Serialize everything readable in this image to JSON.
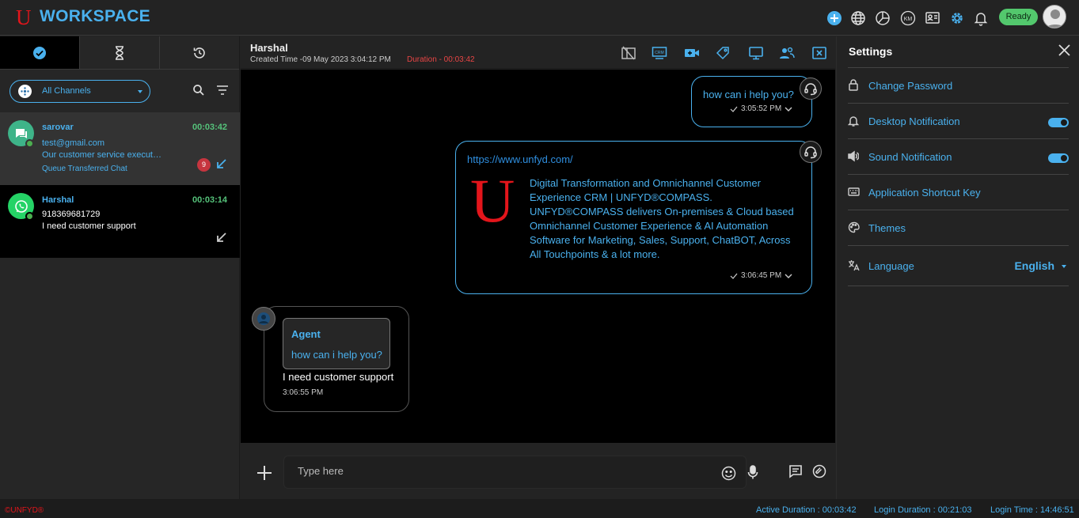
{
  "header": {
    "logo_letter": "U",
    "brand": "WORKSPACE",
    "status_label": "Ready",
    "km_label": "KM"
  },
  "left_panel": {
    "channel_filter": "All Channels",
    "chats": [
      {
        "name": "sarovar",
        "timer": "00:03:42",
        "email": "test@gmail.com",
        "preview": "Our customer service executive will be with you shortly",
        "status": "Queue Transferred Chat",
        "unread": "9",
        "channel": "chat-icon"
      },
      {
        "name": "Harshal",
        "timer": "00:03:14",
        "phone": "918369681729",
        "preview": "I need customer support",
        "channel": "whatsapp-icon"
      }
    ]
  },
  "chat_header": {
    "name": "Harshal",
    "created": "Created Time -09 May 2023 3:04:12 PM",
    "duration": "Duration - 00:03:42"
  },
  "conversation": {
    "msg1": {
      "text": "how can i help you?",
      "time": "3:05:52 PM"
    },
    "msg2": {
      "url": "https://www.unfyd.com/",
      "preview_logo": "U",
      "description": "Digital Transformation and Omnichannel Customer Experience CRM | UNFYD®COMPASS. UNFYD®COMPASS delivers On-premises & Cloud based Omnichannel Customer Experience & AI Automation Software for Marketing, Sales, Support, ChatBOT, Across All Touchpoints & a lot more.",
      "time": "3:06:45 PM"
    },
    "msg3": {
      "quote_author": "Agent",
      "quote_text": "how can i help you?",
      "text": "I need customer support",
      "time": "3:06:55 PM"
    }
  },
  "composer": {
    "placeholder": "Type here"
  },
  "settings": {
    "title": "Settings",
    "items": [
      {
        "label": "Change Password"
      },
      {
        "label": "Desktop Notification",
        "toggle": true
      },
      {
        "label": "Sound Notification",
        "toggle": true
      },
      {
        "label": "Application Shortcut Key"
      },
      {
        "label": "Themes"
      },
      {
        "label": "Language",
        "value": "English"
      }
    ]
  },
  "footer": {
    "copyright": "©UNFYD®",
    "active_duration": "Active Duration : 00:03:42",
    "login_duration": "Login Duration : 00:21:03",
    "login_time": "Login Time : 14:46:51"
  },
  "colors": {
    "accent": "#4ab1ee",
    "brand_red": "#e3151b",
    "ready": "#53c86d",
    "timer_green": "#55c27a",
    "alert_red": "#e84545"
  }
}
